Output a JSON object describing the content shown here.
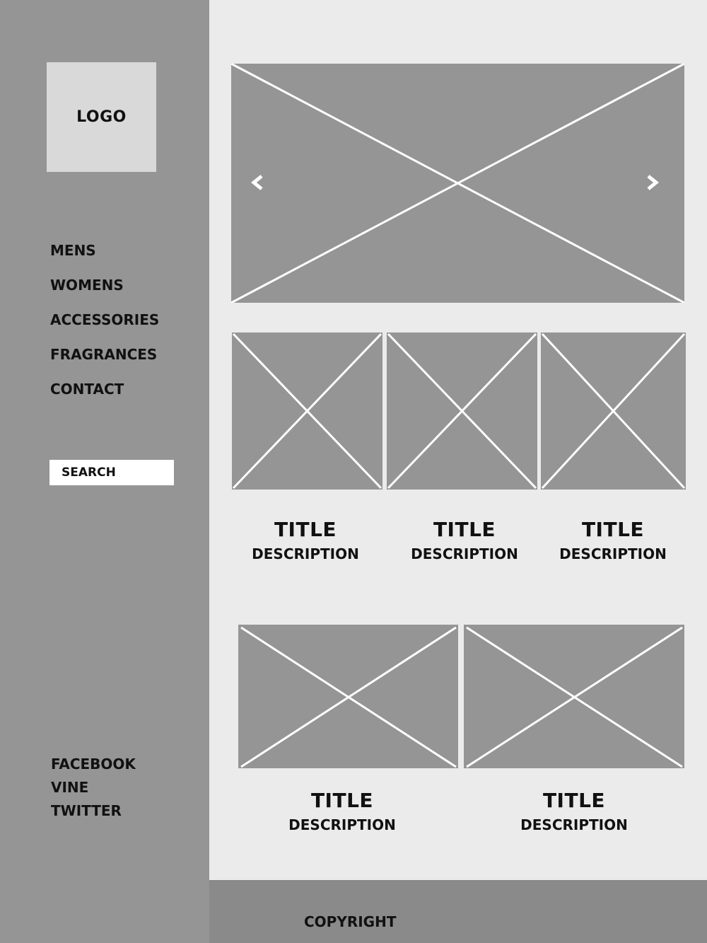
{
  "sidebar": {
    "logo": "LOGO",
    "nav": [
      {
        "label": "MENS"
      },
      {
        "label": "WOMENS"
      },
      {
        "label": "ACCESSORIES"
      },
      {
        "label": "FRAGRANCES"
      },
      {
        "label": "CONTACT"
      }
    ],
    "search": {
      "placeholder": "SEARCH"
    },
    "social": [
      {
        "label": "FACEBOOK"
      },
      {
        "label": "VINE"
      },
      {
        "label": "TWITTER"
      }
    ]
  },
  "carousel": {
    "prev_icon": "chevron-left-icon",
    "next_icon": "chevron-right-icon"
  },
  "row1": [
    {
      "title": "TITLE",
      "description": "DESCRIPTION"
    },
    {
      "title": "TITLE",
      "description": "DESCRIPTION"
    },
    {
      "title": "TITLE",
      "description": "DESCRIPTION"
    }
  ],
  "row2": [
    {
      "title": "TITLE",
      "description": "DESCRIPTION"
    },
    {
      "title": "TITLE",
      "description": "DESCRIPTION"
    }
  ],
  "footer": {
    "copyright": "COPYRIGHT"
  },
  "colors": {
    "sidebar_bg": "#959595",
    "content_bg": "#ebebeb",
    "placeholder_fill": "#959595",
    "placeholder_lines": "#ffffff",
    "logo_bg": "#d9d9d9",
    "footer_bg": "#8a8a8a"
  }
}
